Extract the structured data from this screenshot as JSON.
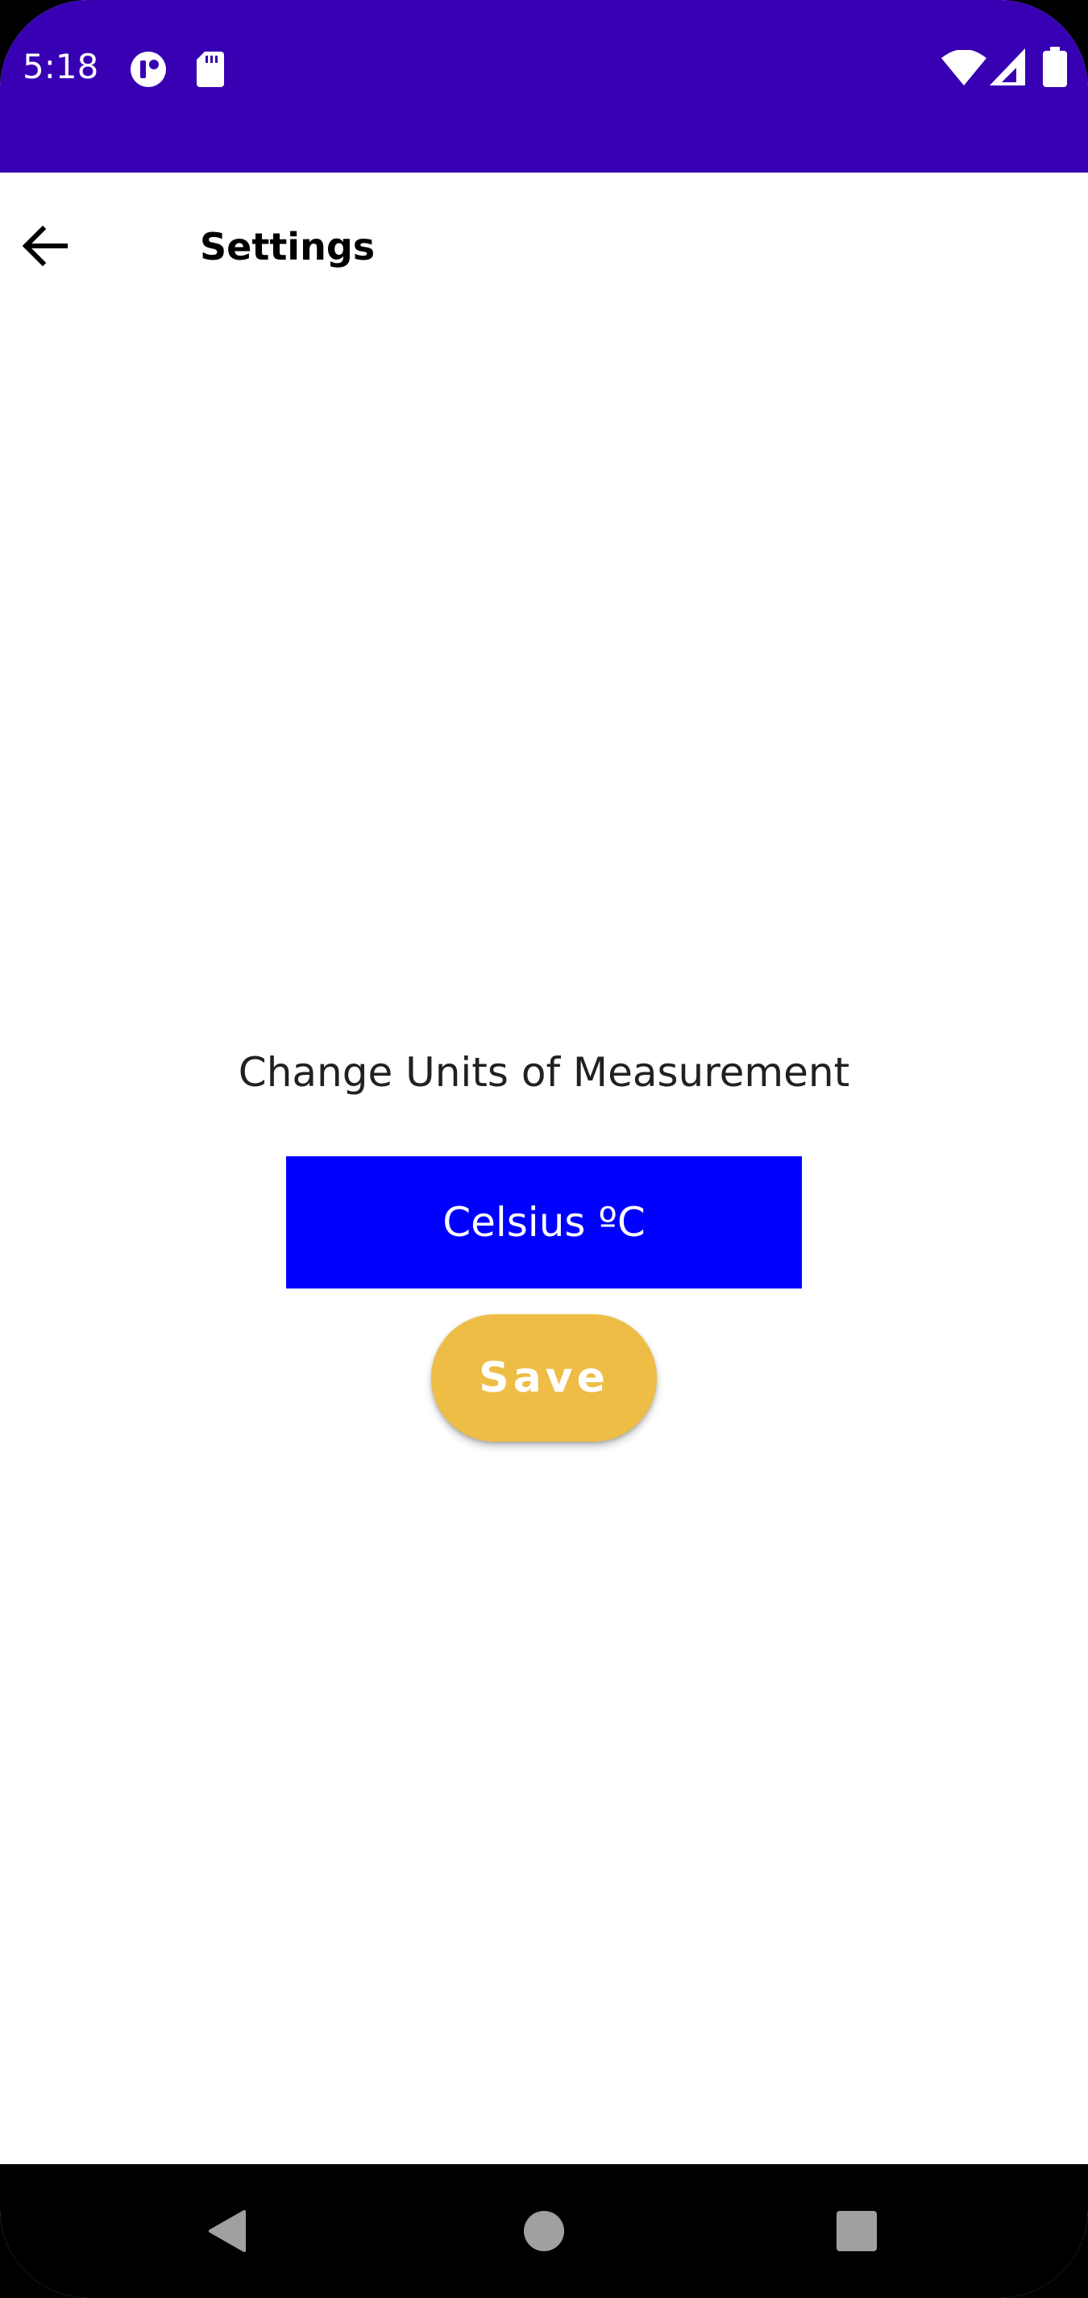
{
  "status_bar": {
    "time": "5:18",
    "left_icons": [
      "app-notification-icon",
      "sd-card-icon"
    ],
    "right_icons": [
      "wifi-icon",
      "cell-signal-icon",
      "battery-icon"
    ],
    "background_color": "#3700b3"
  },
  "toolbar": {
    "back_icon": "arrow-back-icon",
    "title": "Settings"
  },
  "main": {
    "units_label": "Change Units of Measurement",
    "unit_selector": {
      "value": "Celsius ºC",
      "background_color": "#0000ff"
    },
    "save_button": {
      "label": "Save",
      "background_color": "#eebd45"
    }
  },
  "nav_bar": {
    "icons": [
      "nav-back-icon",
      "nav-home-icon",
      "nav-recents-icon"
    ]
  }
}
